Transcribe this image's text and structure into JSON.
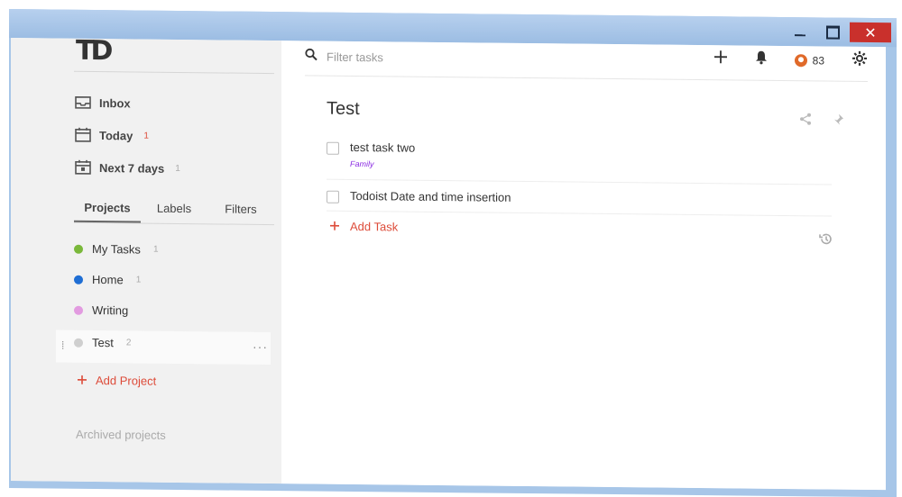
{
  "window": {
    "controls": {
      "minimize": "minimize",
      "maximize": "maximize",
      "close": "✕"
    }
  },
  "sidebar": {
    "logo": "TD",
    "nav": [
      {
        "label": "Inbox",
        "count": ""
      },
      {
        "label": "Today",
        "count": "1"
      },
      {
        "label": "Next 7 days",
        "count": "1"
      }
    ],
    "tabs": [
      "Projects",
      "Labels",
      "Filters"
    ],
    "projects": [
      {
        "name": "My Tasks",
        "count": "1",
        "color": "#7ab83a"
      },
      {
        "name": "Home",
        "count": "1",
        "color": "#1f6ed4"
      },
      {
        "name": "Writing",
        "count": "",
        "color": "#e29be0"
      },
      {
        "name": "Test",
        "count": "2",
        "color": "#cfcfcf"
      }
    ],
    "drag_handle": "⁞",
    "more": "···",
    "add_project": "Add Project",
    "archived": "Archived projects"
  },
  "topbar": {
    "search_placeholder": "Filter tasks",
    "karma": "83"
  },
  "main": {
    "title": "Test",
    "tasks": [
      {
        "name": "test task two",
        "label": "Family"
      },
      {
        "name": "Todoist Date and time insertion",
        "label": ""
      }
    ],
    "add_task": "Add Task"
  },
  "colors": {
    "accent_red": "#dd4b39",
    "close_btn": "#c9302c",
    "label_purple": "#8a2be2"
  },
  "icons": {
    "search": "search-icon",
    "plus": "plus-icon",
    "bell": "bell-icon",
    "gear": "gear-icon",
    "share": "share-icon",
    "pin": "pin-icon",
    "history": "history-icon"
  }
}
